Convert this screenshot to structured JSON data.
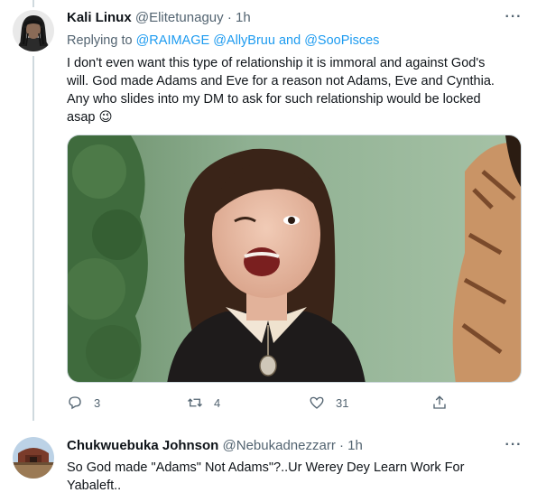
{
  "tweet1": {
    "author_name": "Kali Linux",
    "author_handle": "@Elitetunaguy",
    "separator": "·",
    "time": "1h",
    "replying_to_label": "Replying to",
    "mention1": "@RAIMAGE",
    "mention2": "@AllyBruu",
    "and_label": "and",
    "mention3": "@SooPisces",
    "text_lines": [
      "I don't  even want this type of relationship it is immoral  and against  God's",
      "will. God made  Adams and Eve for a reason  not Adams, Eve and Cynthia.",
      "Any who slides into my DM to ask for such  relationship  would be locked",
      "asap"
    ],
    "emoji": "😉",
    "reply_count": "3",
    "retweet_count": "4",
    "like_count": "31"
  },
  "tweet2": {
    "author_name": "Chukwuebuka Johnson",
    "author_handle": "@Nebukadnezzarr",
    "separator": "·",
    "time": "1h",
    "text_lines": [
      "So God made \"Adams\" Not Adams\"?..Ur Werey Dey Learn Work For",
      "Yabaleft.."
    ]
  },
  "icons": {
    "more": "more-horizontal-icon",
    "reply": "reply-bubble-icon",
    "retweet": "retweet-arrows-icon",
    "like": "heart-icon",
    "share": "share-upload-icon"
  },
  "colors": {
    "link": "#1d9bf0",
    "secondary_text": "#536471",
    "thread_line": "#cfd9de"
  }
}
